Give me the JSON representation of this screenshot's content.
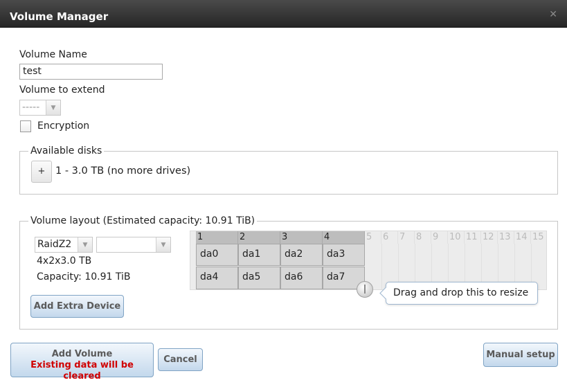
{
  "dialog": {
    "title": "Volume Manager",
    "close_glyph": "✕"
  },
  "form": {
    "volume_name_label": "Volume Name",
    "volume_name_value": "test",
    "volume_extend_label": "Volume to extend",
    "volume_extend_value": "-----",
    "encryption_label": "Encryption",
    "encryption_checked": false
  },
  "available_disks": {
    "legend": "Available disks",
    "add_glyph": "+",
    "info": "1 - 3.0 TB (no more drives)"
  },
  "layout": {
    "legend": "Volume layout (Estimated capacity: 10.91 TiB)",
    "raid_type": "RaidZ2",
    "second_select": "",
    "geometry": "4x2x3.0 TB",
    "capacity": "Capacity: 10.91 TiB",
    "add_extra_device": "Add Extra Device",
    "columns": [
      "1",
      "2",
      "3",
      "4",
      "5",
      "6",
      "7",
      "8",
      "9",
      "10",
      "11",
      "12",
      "13",
      "14",
      "15"
    ],
    "active_columns": 4,
    "disks": [
      [
        "da0",
        "da1",
        "da2",
        "da3"
      ],
      [
        "da4",
        "da5",
        "da6",
        "da7"
      ]
    ],
    "resize_hint": "Drag and drop this to resize"
  },
  "footer": {
    "add_volume": "Add Volume",
    "warning": "Existing data will be cleared",
    "cancel": "Cancel",
    "manual_setup": "Manual setup"
  },
  "colors": {
    "title_bar": "#2e2e2e",
    "button_border": "#7fa3c4",
    "warning_text": "#d00000",
    "grid_cell": "#d7d7d7"
  }
}
